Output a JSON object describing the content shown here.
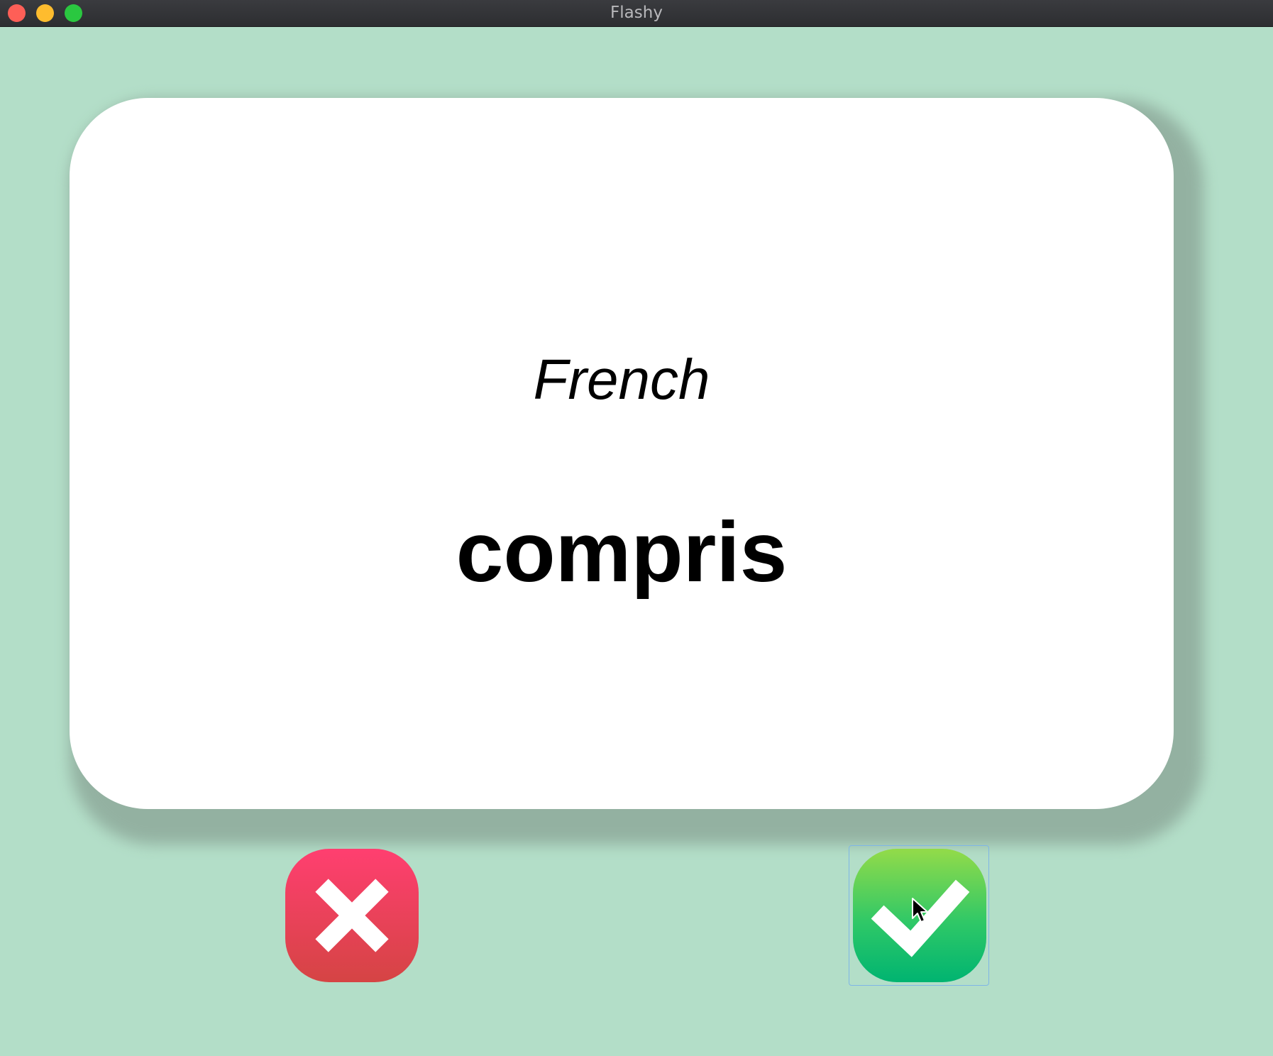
{
  "window": {
    "title": "Flashy"
  },
  "card": {
    "title": "French",
    "word": "compris"
  },
  "colors": {
    "background": "#b3dec8",
    "card": "#ffffff",
    "wrong_button": "#e8475e",
    "right_button": "#22c36a"
  },
  "buttons": {
    "wrong_icon": "close-x-icon",
    "right_icon": "checkmark-icon"
  }
}
